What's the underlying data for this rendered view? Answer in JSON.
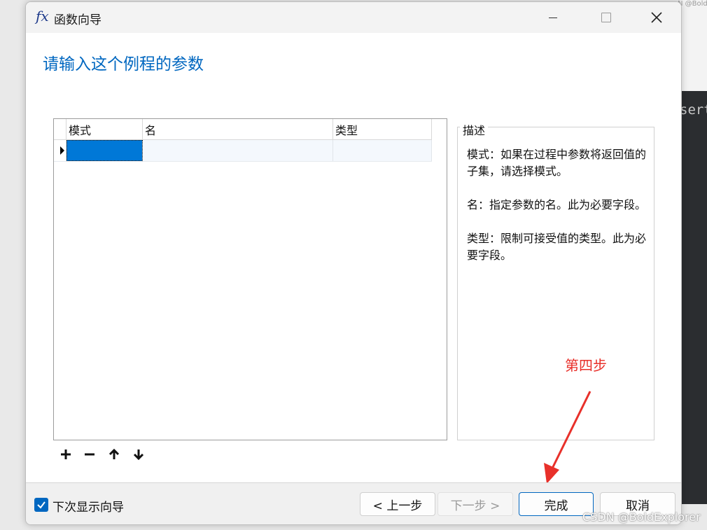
{
  "background": {
    "code_fragment": "sert",
    "watermark_top": "N @Bold"
  },
  "window": {
    "title_icon": "fx",
    "title": "函数向导"
  },
  "page": {
    "heading": "请输入这个例程的参数"
  },
  "grid": {
    "columns": [
      "模式",
      "名",
      "类型"
    ],
    "rows": [
      {
        "mode": "",
        "name": "",
        "type": ""
      }
    ],
    "accent_color": "#0078d7"
  },
  "toolbar": {
    "icons": [
      "add-icon",
      "remove-icon",
      "move-up-icon",
      "move-down-icon"
    ]
  },
  "description": {
    "legend": "描述",
    "paragraphs": [
      "模式：如果在过程中参数将返回值的子集，请选择模式。",
      "名：指定参数的名。此为必要字段。",
      "类型：限制可接受值的类型。此为必要字段。"
    ]
  },
  "annotation": {
    "label": "第四步",
    "color": "#e8302a"
  },
  "footer": {
    "show_wizard_label": "下次显示向导",
    "show_wizard_checked": true,
    "prev_label": "< 上一步",
    "next_label": "下一步 >",
    "finish_label": "完成",
    "cancel_label": "取消"
  },
  "watermark": "CSDN @BoldExplorer"
}
